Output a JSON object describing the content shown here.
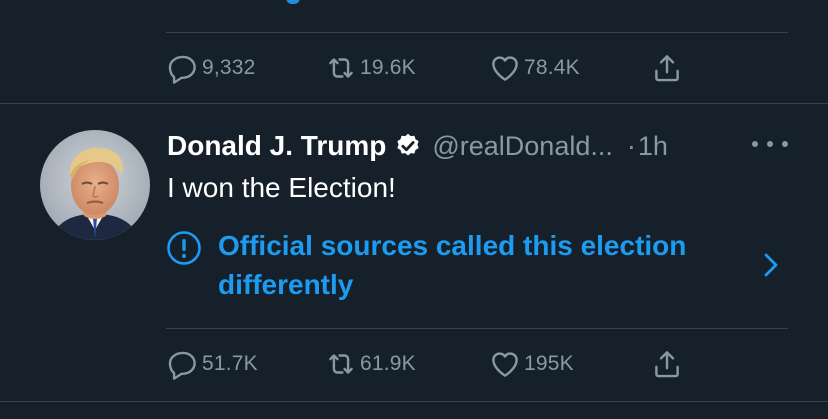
{
  "previous_tweet": {
    "stats": {
      "replies": "9,332",
      "retweets": "19.6K",
      "likes": "78.4K"
    }
  },
  "tweet": {
    "author": {
      "display_name": "Donald J. Trump",
      "handle": "@realDonald...",
      "verified": true
    },
    "separator": "·",
    "time": "1h",
    "text": "I won the Election!",
    "notice": {
      "text": "Official sources called this election differently",
      "icon": "exclamation-circle-icon",
      "color": "#1d9bf0"
    },
    "stats": {
      "replies": "51.7K",
      "retweets": "61.9K",
      "likes": "195K"
    }
  },
  "theme": {
    "background": "#15202b",
    "secondary_text": "#8899a6",
    "divider": "#38444d",
    "accent": "#1d9bf0"
  }
}
